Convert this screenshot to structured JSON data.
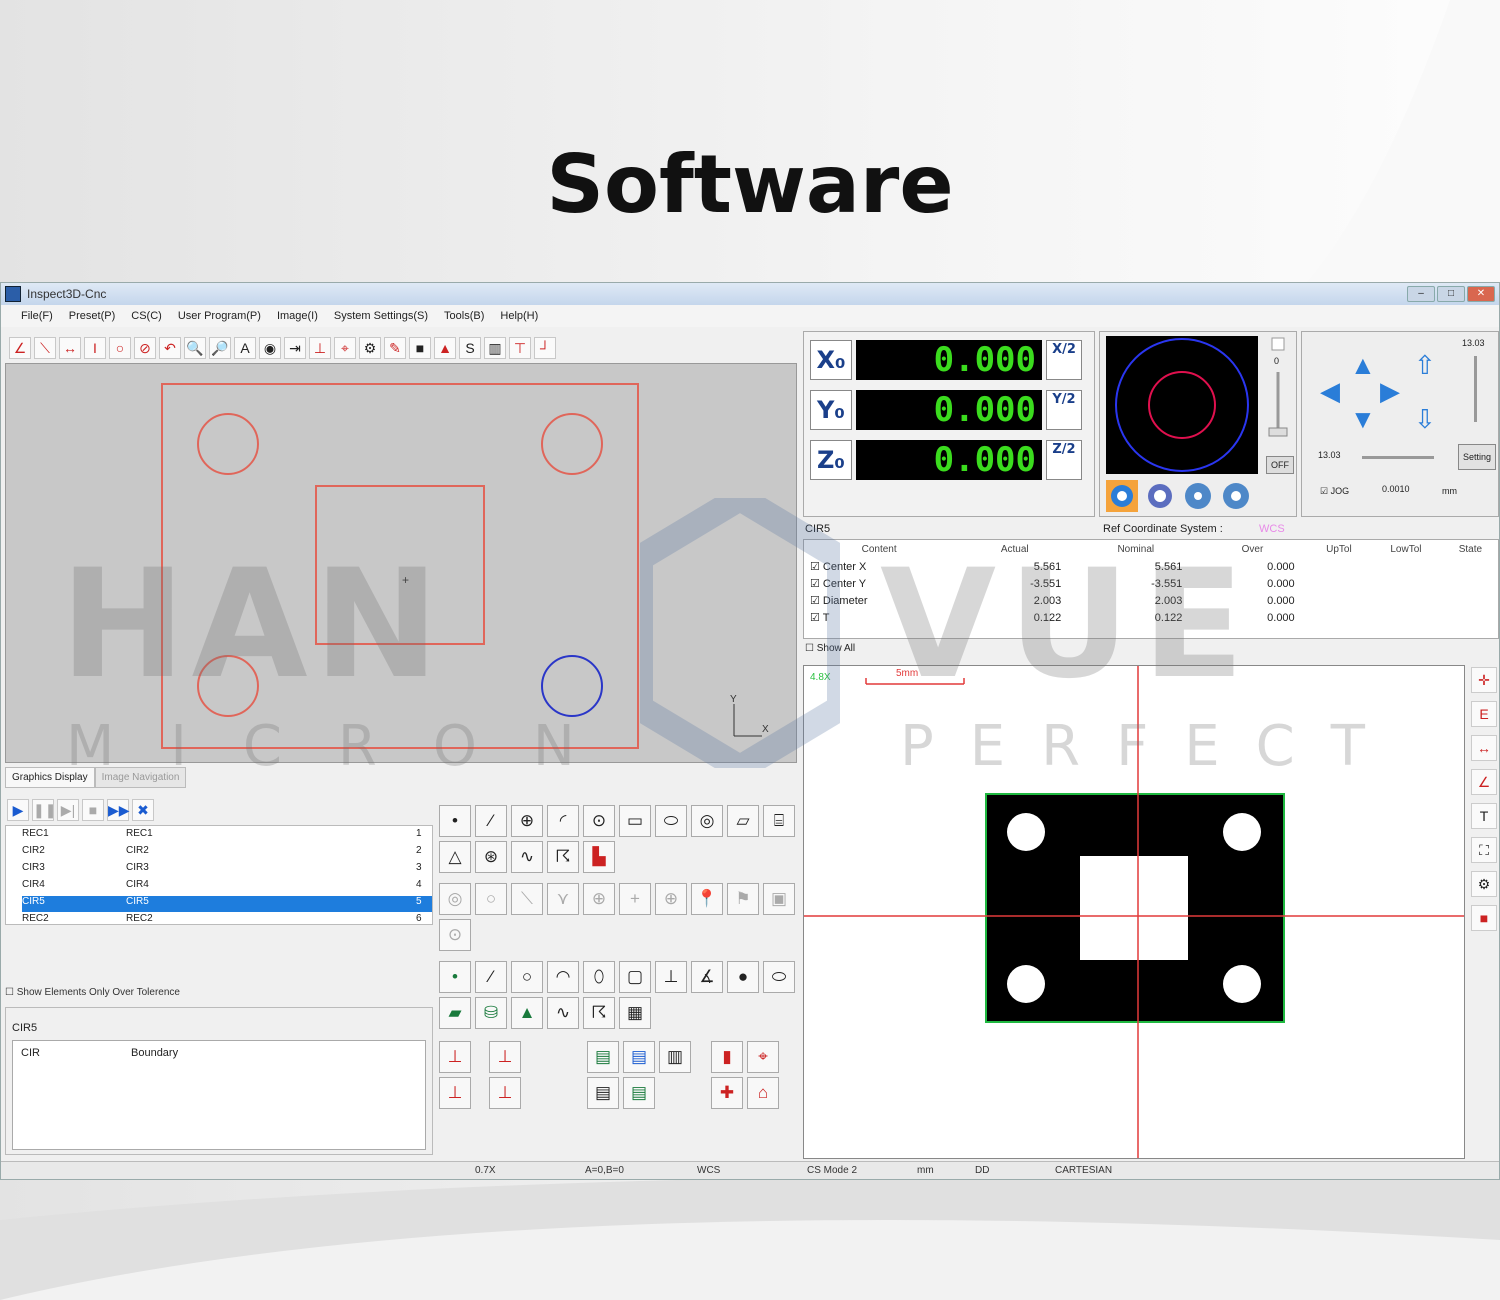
{
  "page_title": "Software",
  "window": {
    "title": "Inspect3D-Cnc"
  },
  "menu": [
    "File(F)",
    "Preset(P)",
    "CS(C)",
    "User Program(P)",
    "Image(I)",
    "System Settings(S)",
    "Tools(B)",
    "Help(H)"
  ],
  "dro": {
    "axes": [
      {
        "label": "X₀",
        "value": "0.000",
        "half": "X/2"
      },
      {
        "label": "Y₀",
        "value": "0.000",
        "half": "Y/2"
      },
      {
        "label": "Z₀",
        "value": "0.000",
        "half": "Z/2"
      }
    ]
  },
  "camera": {
    "off_label": "OFF",
    "slider_top": "0"
  },
  "jog": {
    "value_top": "13.03",
    "value_left": "13.03",
    "setting_label": "Setting",
    "jog_label": "JOG",
    "step": "0.0010",
    "unit": "mm"
  },
  "measure": {
    "element": "CIR5",
    "ref_label": "Ref Coordinate System :",
    "ref_value": "WCS",
    "headers": [
      "Content",
      "Actual",
      "Nominal",
      "Over",
      "UpTol",
      "LowTol",
      "State"
    ],
    "rows": [
      {
        "content": "Center X",
        "actual": "5.561",
        "nominal": "5.561",
        "over": "0.000"
      },
      {
        "content": "Center Y",
        "actual": "-3.551",
        "nominal": "-3.551",
        "over": "0.000"
      },
      {
        "content": "Diameter",
        "actual": "2.003",
        "nominal": "2.003",
        "over": "0.000"
      },
      {
        "content": "T",
        "actual": "0.122",
        "nominal": "0.122",
        "over": "0.000"
      }
    ],
    "show_all": "Show All"
  },
  "live": {
    "zoom": "4.8X",
    "scale": "5mm"
  },
  "tabs": [
    "Graphics Display",
    "Image Navigation"
  ],
  "program": {
    "rows": [
      {
        "a": "REC1",
        "b": "REC1",
        "n": "1"
      },
      {
        "a": "CIR2",
        "b": "CIR2",
        "n": "2"
      },
      {
        "a": "CIR3",
        "b": "CIR3",
        "n": "3"
      },
      {
        "a": "CIR4",
        "b": "CIR4",
        "n": "4"
      },
      {
        "a": "CIR5",
        "b": "CIR5",
        "n": "5"
      },
      {
        "a": "REC2",
        "b": "REC2",
        "n": "6"
      }
    ],
    "selected_index": 4
  },
  "show_over_tol": "Show Elements Only Over Tolerence",
  "element_box": {
    "title": "CIR5",
    "col1": "CIR",
    "col2": "Boundary"
  },
  "status": [
    "0.7X",
    "A=0,B=0",
    "WCS",
    "CS Mode 2",
    "mm",
    "DD",
    "CARTESIAN"
  ],
  "watermark": {
    "left_big": "HAN",
    "left_small": "MICRON",
    "right_big": "VUE",
    "right_small": "PERFECT"
  },
  "colors": {
    "dro_digits": "#3bdc1e",
    "selection": "#1e7ddd",
    "ref_value": "#e88ae8",
    "crosshair": "#e23a3a"
  }
}
